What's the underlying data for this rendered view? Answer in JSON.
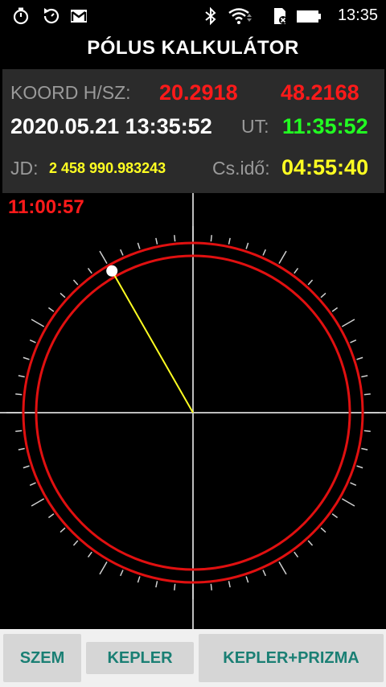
{
  "status_bar": {
    "time": "13:35",
    "left_icons": [
      "stopwatch-icon",
      "sync-timer-icon",
      "gmail-icon"
    ],
    "right_icons": [
      "bluetooth-icon",
      "wifi-icon",
      "sd-card-icon",
      "battery-icon"
    ]
  },
  "app": {
    "title": "PÓLUS KALKULÁTOR"
  },
  "info": {
    "coord_label": "KOORD H/SZ:",
    "longitude": "20.2918",
    "latitude": "48.2168",
    "datetime": "2020.05.21 13:35:52",
    "ut_label": "UT:",
    "ut_value": "11:35:52",
    "jd_label": "JD:",
    "jd_value": "2 458 990.983243",
    "sidereal_label": "Cs.idő:",
    "sidereal_value": "04:55:40"
  },
  "polar_scope": {
    "hour_angle_text": "11:00:57",
    "hour_angle_fraction": 0.9173
  },
  "buttons": {
    "szem": "SZEM",
    "kepler": "KEPLER",
    "kepler_prizma": "KEPLER+PRIZMA"
  },
  "colors": {
    "red": "#ff1a1a",
    "green": "#22ff22",
    "yellow": "#ffff22",
    "button_text": "#1a7f74"
  }
}
